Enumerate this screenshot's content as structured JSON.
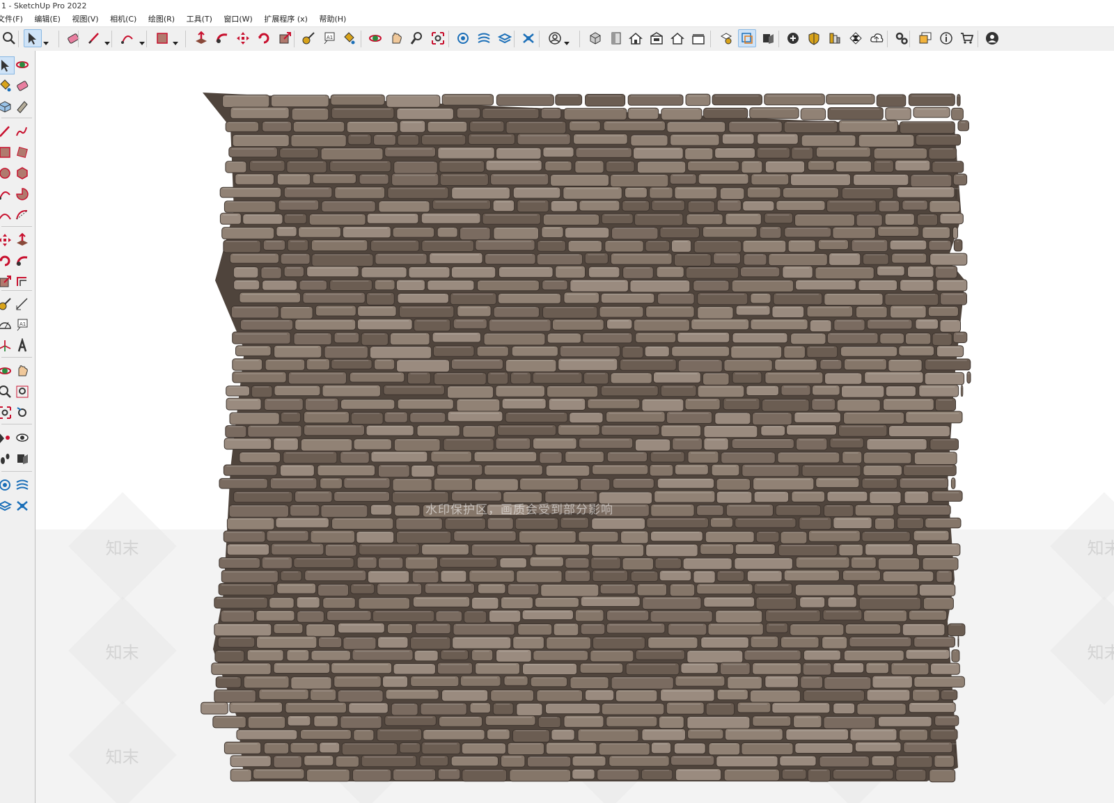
{
  "window": {
    "title": "1 - SketchUp Pro 2022"
  },
  "menubar": {
    "items": [
      "文件(F)",
      "编辑(E)",
      "视图(V)",
      "相机(C)",
      "绘图(R)",
      "工具(T)",
      "窗口(W)",
      "扩展程序 (x)",
      "帮助(H)"
    ]
  },
  "toolbar": {
    "icons": [
      "zoom-icon",
      "select-icon",
      "eraser-icon",
      "pencil-line-icon",
      "arc-icon",
      "rectangle-icon",
      "push-pull-icon",
      "follow-me-icon",
      "move-icon",
      "rotate-icon",
      "scale-icon",
      "tape-measure-icon",
      "text-icon",
      "paint-bucket-icon",
      "orbit-icon",
      "pan-icon",
      "zoom-tool-icon",
      "zoom-extents-icon",
      "warehouse-icon",
      "extension-warehouse-icon",
      "layout-icon",
      "extension-manager-icon",
      "user-icon",
      "iso-view-icon",
      "top-view-icon",
      "front-view-icon",
      "right-view-icon",
      "back-view-icon",
      "left-view-icon",
      "solid-tools-icon",
      "outer-shell-icon",
      "section-plane-icon",
      "add-location-icon",
      "sandbox-icon",
      "styles-icon",
      "shadows-icon",
      "cloud-icon",
      "settings-icon",
      "message-icon",
      "info-icon",
      "cart-icon",
      "account-icon"
    ]
  },
  "lefttoolbar": {
    "icons": [
      "select-icon",
      "orbit-icon",
      "paint-bucket-icon",
      "eraser-icon",
      "component-icon",
      "tag-icon",
      "line-icon",
      "freehand-icon",
      "rectangle-icon",
      "rotated-rectangle-icon",
      "circle-icon",
      "polygon-icon",
      "arc-icon",
      "pie-icon",
      "two-point-arc-icon",
      "three-point-arc-icon",
      "move-icon",
      "push-pull-icon",
      "rotate-icon",
      "follow-me-icon",
      "scale-icon",
      "offset-icon",
      "tape-measure-icon",
      "dimension-icon",
      "protractor-icon",
      "text-icon",
      "axes-icon",
      "3d-text-icon",
      "orbit-view-icon",
      "pan-icon",
      "zoom-icon",
      "zoom-window-icon",
      "zoom-extents-icon",
      "previous-view-icon",
      "position-camera-icon",
      "look-around-icon",
      "walk-icon",
      "section-plane-icon",
      "warehouse-icon",
      "extension-icon",
      "layout-icon",
      "extension-manager-icon"
    ]
  },
  "viewport": {
    "watermark_text": "水印保护区，画质会受到部分影响",
    "watermark_brand": "知末",
    "wall_color": "#7d6e63",
    "wall_mortar_color": "#4f443c",
    "stone_light": "#9a8b7f",
    "stone_mid": "#857669",
    "stone_dark": "#6b5d52"
  }
}
